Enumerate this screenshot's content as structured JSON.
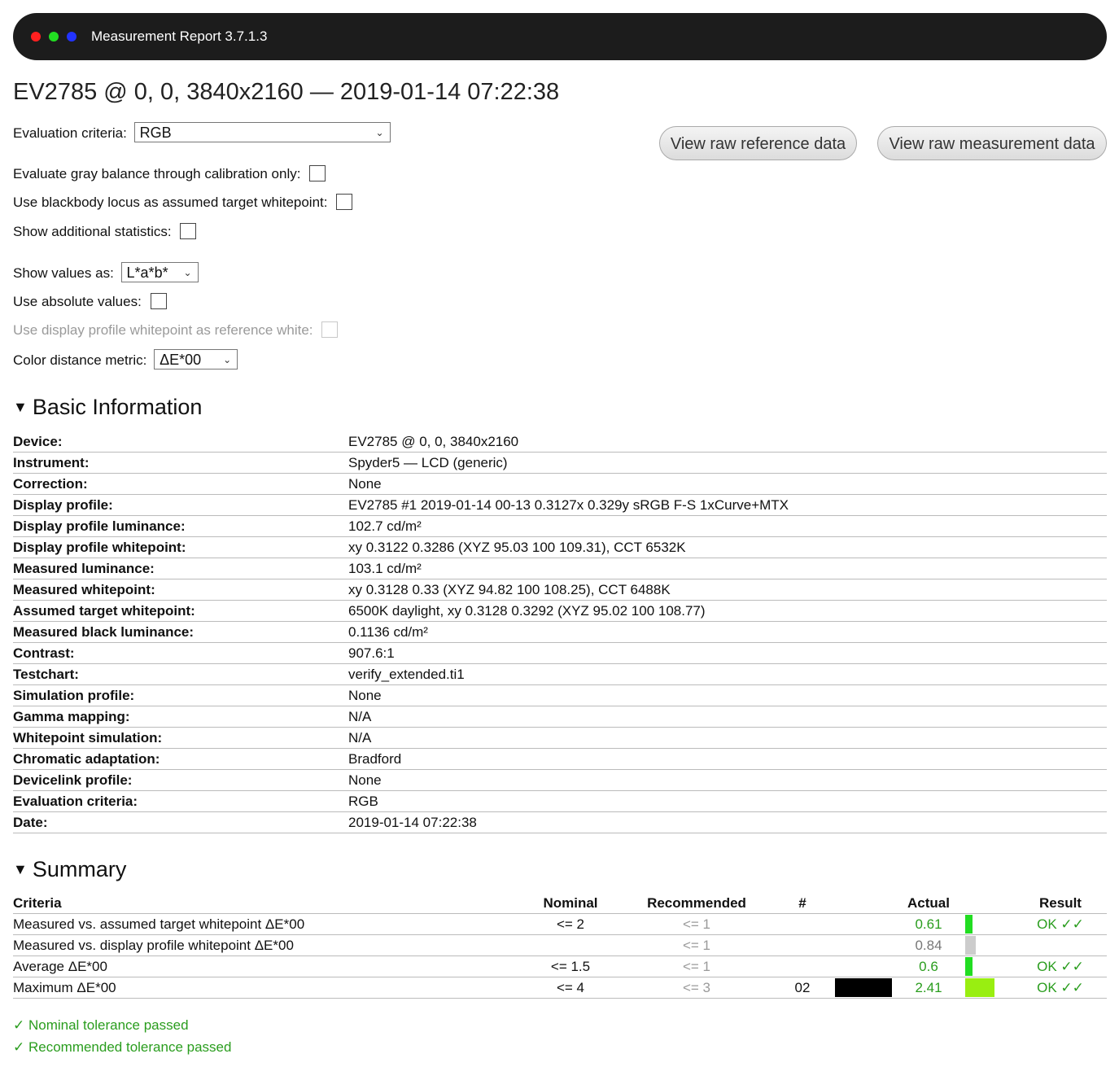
{
  "window": {
    "title": "Measurement Report 3.7.1.3",
    "dot_colors": [
      "#ff2020",
      "#22dd22",
      "#2233ff"
    ]
  },
  "report_title": "EV2785 @ 0, 0, 3840x2160 — 2019-01-14 07:22:38",
  "controls": {
    "evaluation_criteria_label": "Evaluation criteria:",
    "evaluation_criteria_value": "RGB",
    "gray_balance_label": "Evaluate gray balance through calibration only:",
    "blackbody_label": "Use blackbody locus as assumed target whitepoint:",
    "additional_stats_label": "Show additional statistics:",
    "show_values_label": "Show values as:",
    "show_values_value": "L*a*b*",
    "absolute_values_label": "Use absolute values:",
    "profile_whitepoint_label": "Use display profile whitepoint as reference white:",
    "metric_label": "Color distance metric:",
    "metric_value": "ΔE*00",
    "view_reference_button": "View raw reference data",
    "view_measurement_button": "View raw measurement data"
  },
  "basic_info": {
    "heading": "Basic Information",
    "rows": [
      {
        "key": "Device:",
        "value": "EV2785 @ 0, 0, 3840x2160"
      },
      {
        "key": "Instrument:",
        "value": "Spyder5 — LCD (generic)"
      },
      {
        "key": "Correction:",
        "value": "None"
      },
      {
        "key": "Display profile:",
        "value": "EV2785 #1 2019-01-14 00-13 0.3127x 0.329y sRGB F-S 1xCurve+MTX"
      },
      {
        "key": "Display profile luminance:",
        "value": "102.7 cd/m²"
      },
      {
        "key": "Display profile whitepoint:",
        "value": "xy 0.3122 0.3286 (XYZ 95.03 100 109.31), CCT 6532K"
      },
      {
        "key": "Measured luminance:",
        "value": "103.1 cd/m²"
      },
      {
        "key": "Measured whitepoint:",
        "value": "xy 0.3128 0.33 (XYZ 94.82 100 108.25), CCT 6488K"
      },
      {
        "key": "Assumed target whitepoint:",
        "value": "6500K daylight, xy 0.3128 0.3292 (XYZ 95.02 100 108.77)"
      },
      {
        "key": "Measured black luminance:",
        "value": "0.1136 cd/m²"
      },
      {
        "key": "Contrast:",
        "value": "907.6:1"
      },
      {
        "key": "Testchart:",
        "value": "verify_extended.ti1"
      },
      {
        "key": "Simulation profile:",
        "value": "None"
      },
      {
        "key": "Gamma mapping:",
        "value": "N/A"
      },
      {
        "key": "Whitepoint simulation:",
        "value": "N/A"
      },
      {
        "key": "Chromatic adaptation:",
        "value": "Bradford"
      },
      {
        "key": "Devicelink profile:",
        "value": "None"
      },
      {
        "key": "Evaluation criteria:",
        "value": "RGB"
      },
      {
        "key": "Date:",
        "value": "2019-01-14 07:22:38"
      }
    ]
  },
  "summary": {
    "heading": "Summary",
    "columns": [
      "Criteria",
      "Nominal",
      "Recommended",
      "#",
      "Actual",
      "Result"
    ],
    "rows": [
      {
        "criteria": "Measured vs. assumed target whitepoint ΔE*00",
        "nominal": "<= 2",
        "recommended": "<= 1",
        "num": "",
        "swatch": "",
        "actual": "0.61",
        "actual_fraction": 0.61,
        "bar_color": "#22dd22",
        "result": "OK ✓✓",
        "status": "good"
      },
      {
        "criteria": "Measured vs. display profile whitepoint ΔE*00",
        "nominal": "",
        "recommended": "<= 1",
        "num": "",
        "swatch": "",
        "actual": "0.84",
        "actual_fraction": 0.84,
        "bar_color": "#cccccc",
        "result": "",
        "status": "neutral"
      },
      {
        "criteria": "Average ΔE*00",
        "nominal": "<= 1.5",
        "recommended": "<= 1",
        "num": "",
        "swatch": "",
        "actual": "0.6",
        "actual_fraction": 0.6,
        "bar_color": "#22dd22",
        "result": "OK ✓✓",
        "status": "good"
      },
      {
        "criteria": "Maximum ΔE*00",
        "nominal": "<= 4",
        "recommended": "<= 3",
        "num": "02",
        "swatch": "#000000",
        "actual": "2.41",
        "actual_fraction": 2.41,
        "bar_color": "#99ee11",
        "result": "OK ✓✓",
        "status": "good"
      }
    ],
    "passed": [
      "✓ Nominal tolerance passed",
      "✓ Recommended tolerance passed"
    ]
  },
  "colors": {
    "ok_green": "#2a9d1e"
  }
}
